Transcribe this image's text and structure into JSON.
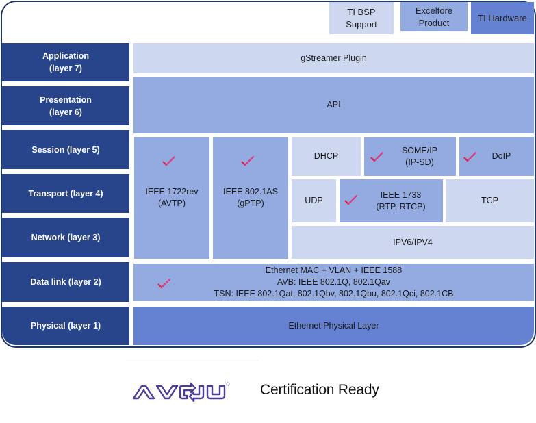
{
  "legend": [
    {
      "label": "TI BSP\nSupport",
      "color": "#cdd7ef"
    },
    {
      "label": "Excelfore\nProduct",
      "color": "#93abe0"
    },
    {
      "label": "TI Hardware",
      "color": "#6581d2"
    }
  ],
  "layers": [
    {
      "label": "Application\n(layer 7)"
    },
    {
      "label": "Presentation\n(layer 6)"
    },
    {
      "label": "Session (layer 5)"
    },
    {
      "label": "Transport (layer 4)"
    },
    {
      "label": "Network (layer 3)"
    },
    {
      "label": "Data link (layer 2)"
    },
    {
      "label": "Physical (layer 1)"
    }
  ],
  "blocks": {
    "gstreamer": "gStreamer Plugin",
    "api": "API",
    "avtp": "IEEE 1722rev\n(AVTP)",
    "gptp": "IEEE 802.1AS\n(gPTP)",
    "dhcp": "DHCP",
    "someip": "SOME/IP\n(IP-SD)",
    "doip": "DoIP",
    "udp": "UDP",
    "ieee1733": "IEEE 1733\n(RTP, RTCP)",
    "tcp": "TCP",
    "ipv": "IPV6/IPV4",
    "datalink": "Ethernet MAC + VLAN + IEEE 1588\nAVB:  IEEE 802.1Q, 802.1Qav\nTSN: IEEE 802.1Qat, 802.1Qbv, 802.1Qbu, 802.1Qci, 802.1CB",
    "physical": "Ethernet Physical Layer"
  },
  "certified_marker": "checkmark-icon",
  "footer": {
    "logo": "AVnu",
    "text": "Certification Ready"
  }
}
